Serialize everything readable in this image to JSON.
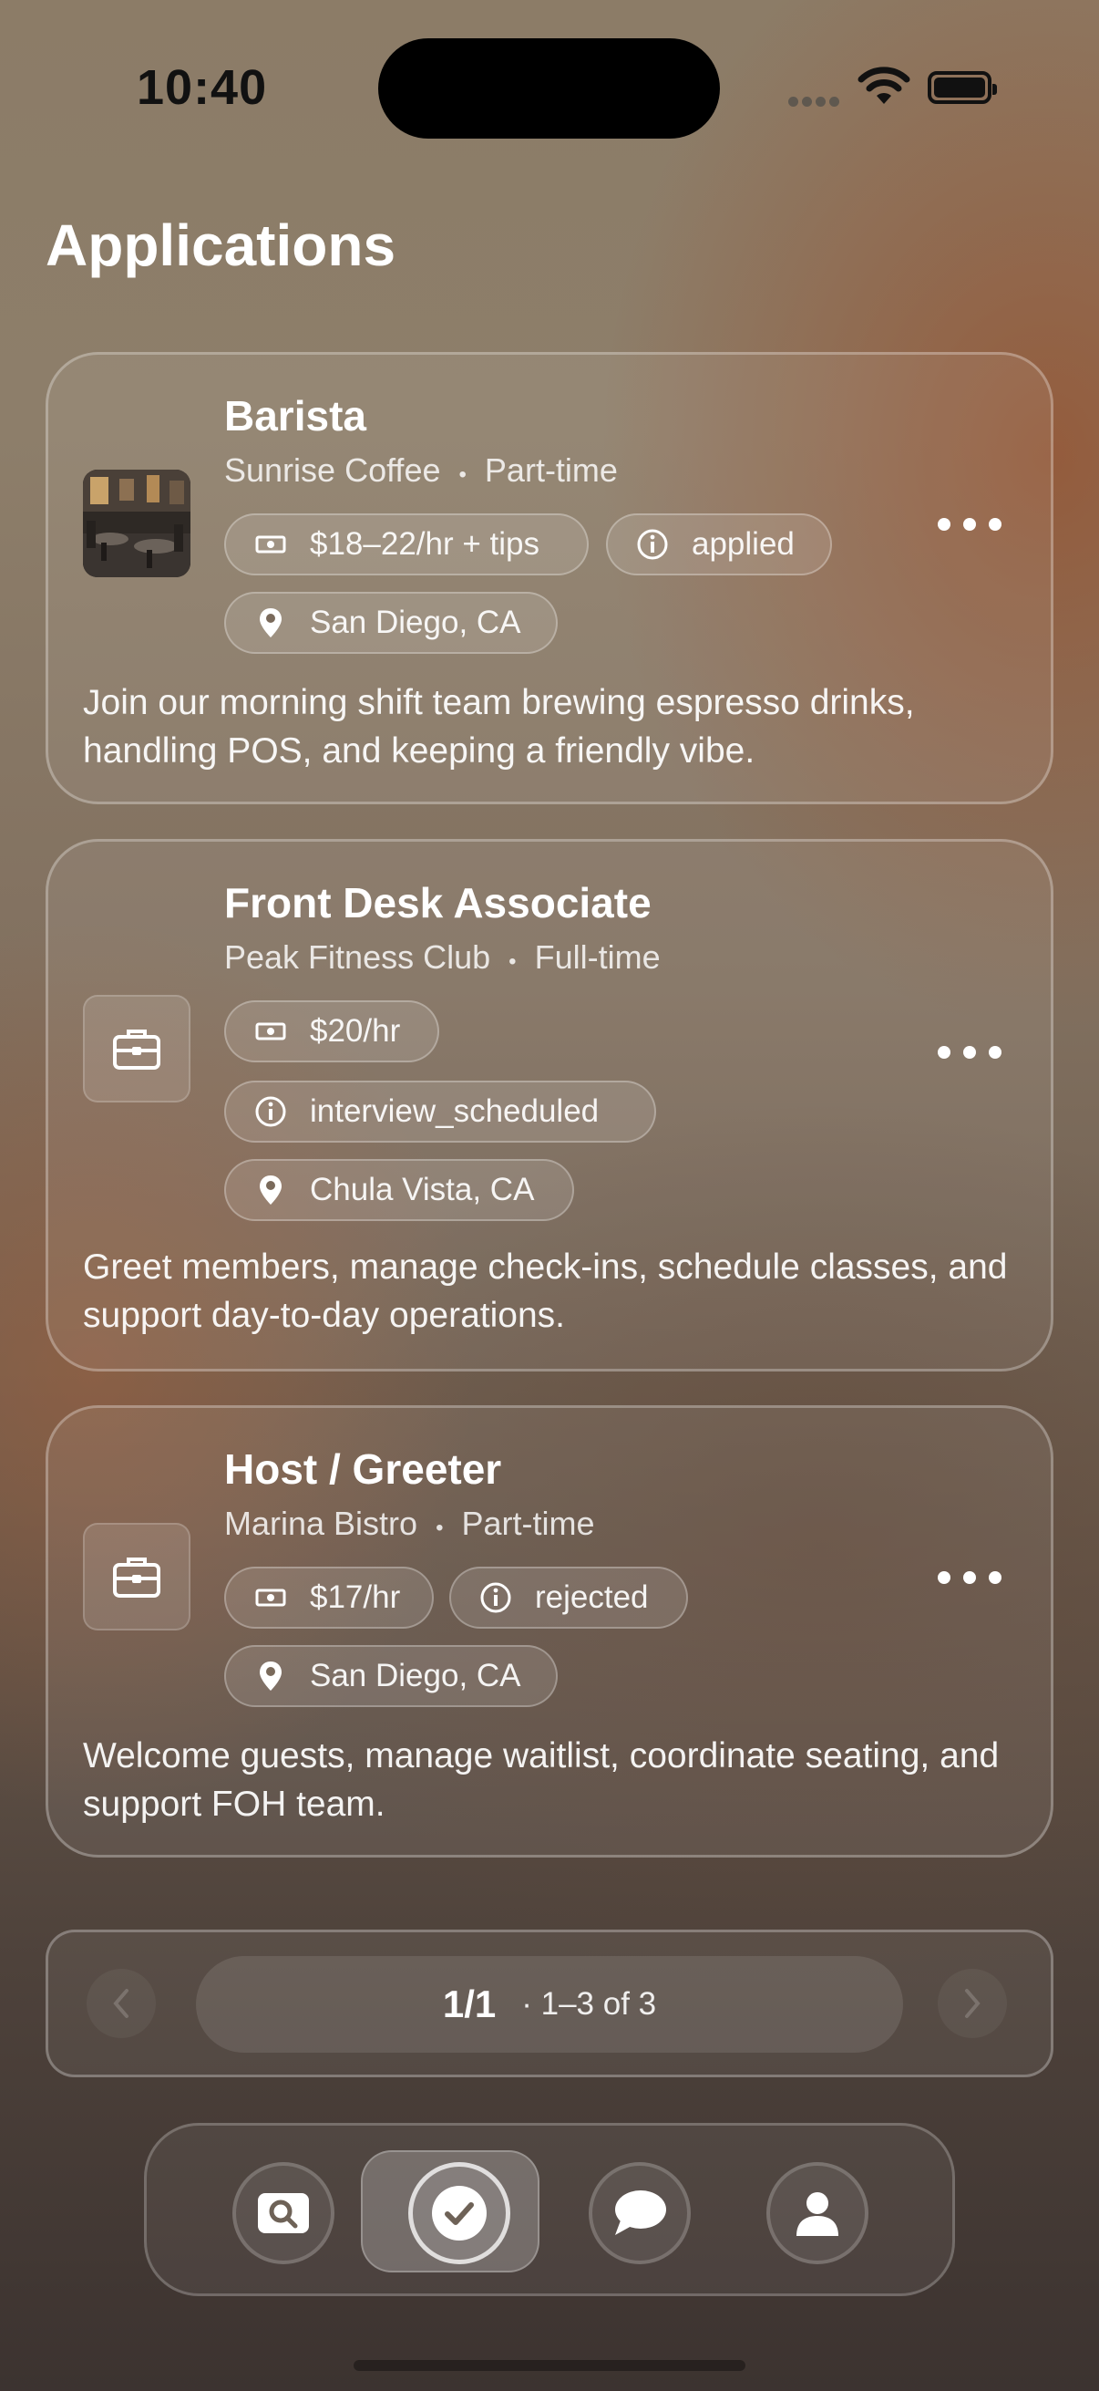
{
  "status_bar": {
    "time": "10:40"
  },
  "page": {
    "title": "Applications"
  },
  "applications": [
    {
      "title": "Barista",
      "company": "Sunrise Coffee",
      "employment_type": "Part-time",
      "pay": "$18–22/hr + tips",
      "status": "applied",
      "location": "San Diego, CA",
      "description": "Join our morning shift team brewing espresso drinks, handling POS, and keeping a friendly vibe.",
      "icon": "restaurant-photo"
    },
    {
      "title": "Front Desk Associate",
      "company": "Peak Fitness Club",
      "employment_type": "Full-time",
      "pay": "$20/hr",
      "status": "interview_scheduled",
      "location": "Chula Vista, CA",
      "description": "Greet members, manage check-ins, schedule classes, and support day-to-day operations.",
      "icon": "briefcase-icon"
    },
    {
      "title": "Host / Greeter",
      "company": "Marina Bistro",
      "employment_type": "Part-time",
      "pay": "$17/hr",
      "status": "rejected",
      "location": "San Diego, CA",
      "description": "Welcome guests, manage waitlist, coordinate seating, and support FOH team.",
      "icon": "briefcase-icon"
    }
  ],
  "separator": "•",
  "pagination": {
    "page": "1/1",
    "range": "· 1–3 of 3"
  },
  "tab_bar": {
    "tabs": [
      {
        "name": "search",
        "icon": "search-icon"
      },
      {
        "name": "applications",
        "icon": "checkmark-icon",
        "active": true
      },
      {
        "name": "messages",
        "icon": "chat-bubble-icon"
      },
      {
        "name": "profile",
        "icon": "person-icon"
      }
    ]
  }
}
